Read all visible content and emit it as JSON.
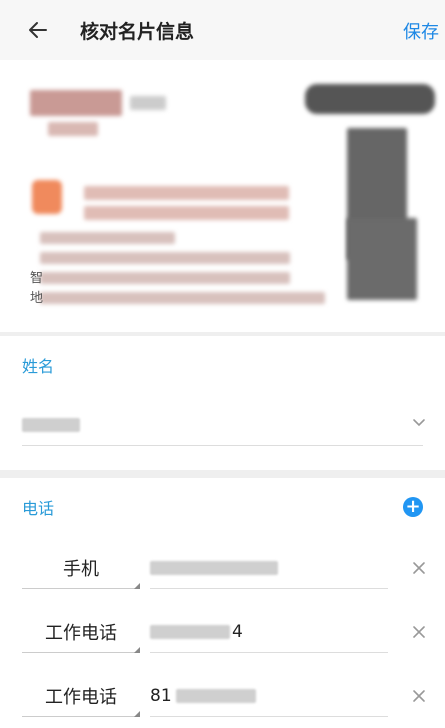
{
  "header": {
    "back_icon": "arrow-left-icon",
    "title": "核对名片信息",
    "save_label": "保存"
  },
  "card_image": {
    "visible_chars": [
      "智",
      "地"
    ]
  },
  "name_section": {
    "label": "姓名",
    "value": "",
    "dropdown_icon": "chevron-down-icon"
  },
  "phone_section": {
    "label": "电话",
    "add_icon": "plus-circle-icon",
    "rows": [
      {
        "type": "手机",
        "number": ""
      },
      {
        "type": "工作电话",
        "number": "4"
      },
      {
        "type": "工作电话",
        "number": "81"
      }
    ],
    "clear_icon": "close-icon"
  },
  "colors": {
    "accent": "#1e88e5",
    "section_label": "#2a9bd8"
  }
}
